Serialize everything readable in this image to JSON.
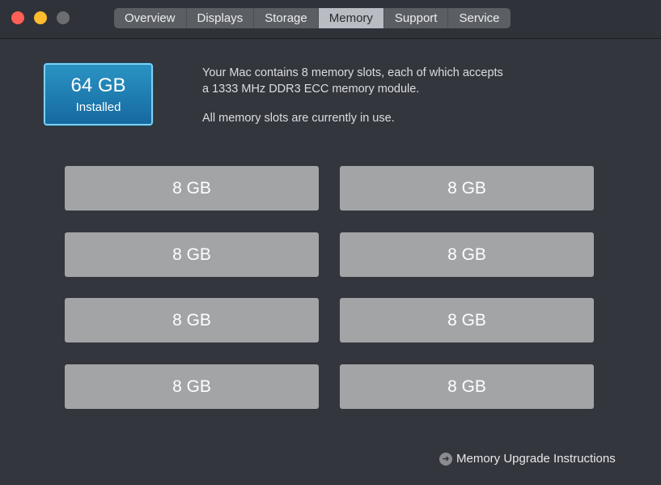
{
  "window": {
    "controls": {
      "close_color": "#fe5f57",
      "minimize_color": "#febc2e",
      "zoom_color": "#6b6d71"
    }
  },
  "tabs": [
    {
      "label": "Overview"
    },
    {
      "label": "Displays"
    },
    {
      "label": "Storage"
    },
    {
      "label": "Memory",
      "active": true
    },
    {
      "label": "Support"
    },
    {
      "label": "Service"
    }
  ],
  "summary": {
    "amount": "64 GB",
    "label": "Installed"
  },
  "info": {
    "line1": "Your Mac contains 8 memory slots, each of which accepts",
    "line2": "a 1333 MHz DDR3 ECC memory module.",
    "status": "All memory slots are currently in use."
  },
  "slots": [
    "8 GB",
    "8 GB",
    "8 GB",
    "8 GB",
    "8 GB",
    "8 GB",
    "8 GB",
    "8 GB"
  ],
  "link": {
    "label": "Memory Upgrade Instructions",
    "icon": "arrow-circle-right-icon"
  }
}
